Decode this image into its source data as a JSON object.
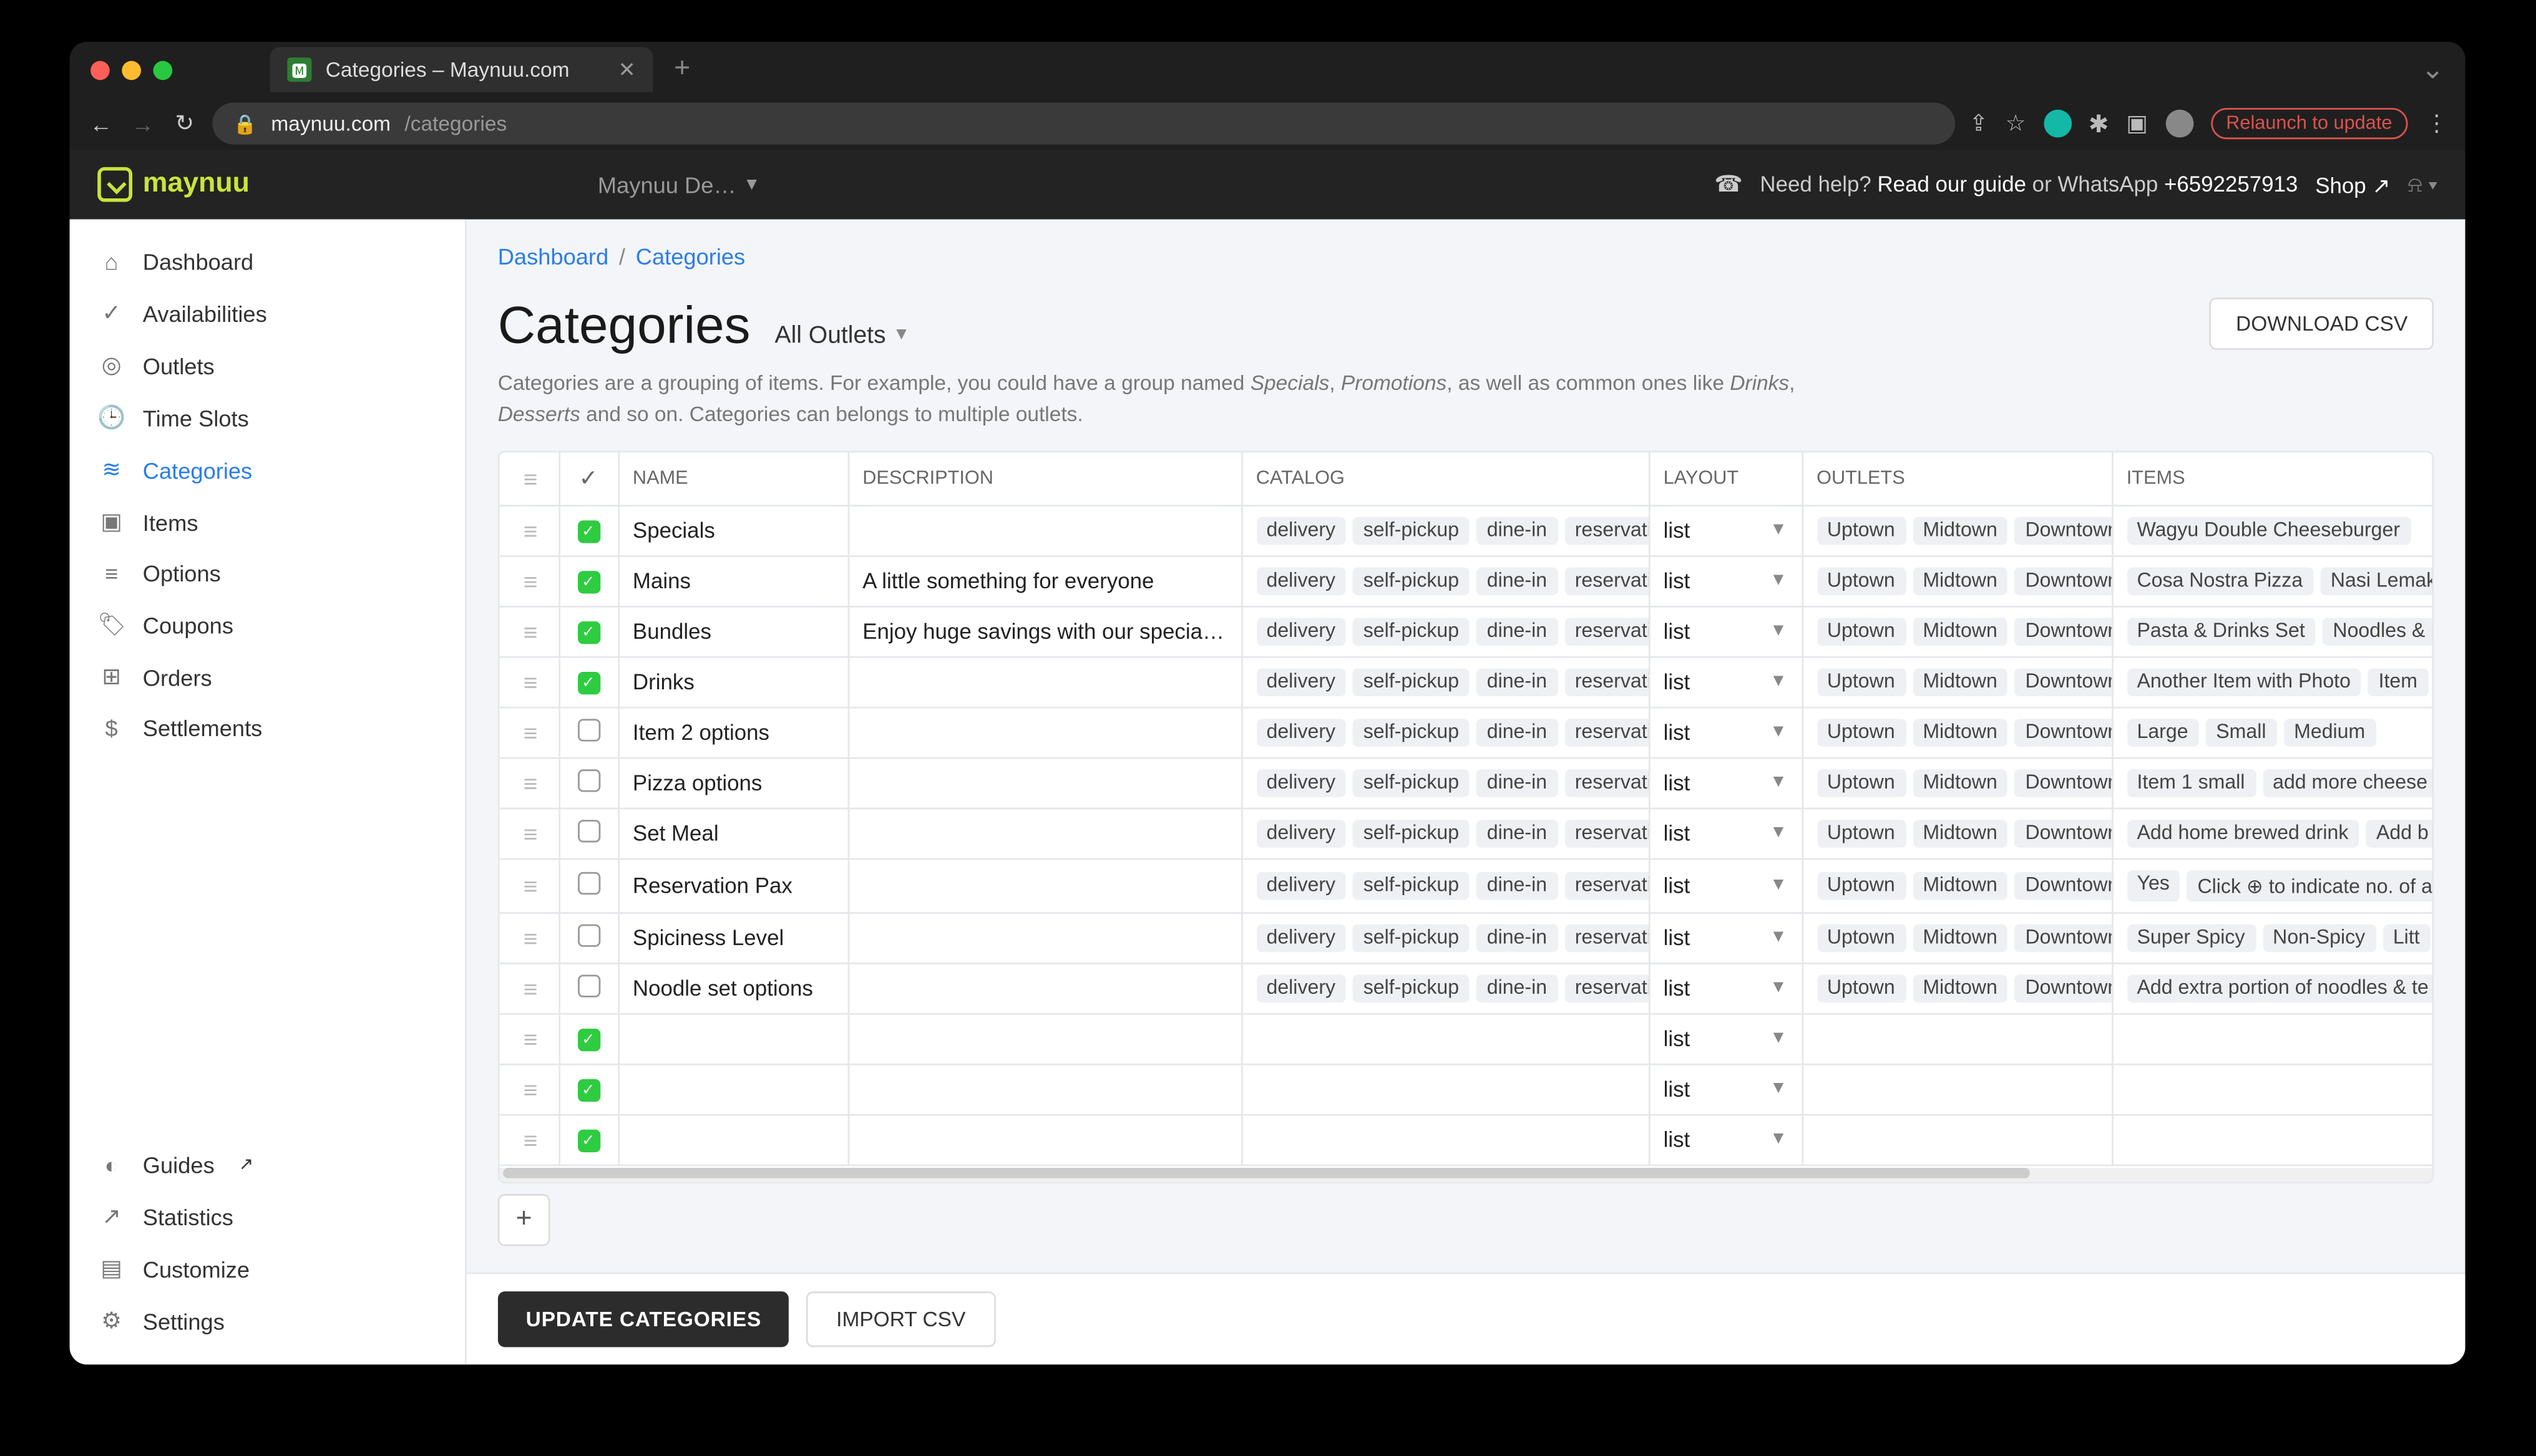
{
  "browser": {
    "tab_title": "Categories – Maynuu.com",
    "url_domain": "maynuu.com",
    "url_path": "/categories",
    "relaunch_label": "Relaunch to update"
  },
  "header": {
    "brand": "maynuu",
    "merchant": "Maynuu De…",
    "help_prefix": "Need help? ",
    "help_guide": "Read our guide",
    "help_or": " or WhatsApp ",
    "help_number": "+6592257913",
    "shop_label": "Shop"
  },
  "sidebar": {
    "top": [
      {
        "icon": "⌂",
        "label": "Dashboard"
      },
      {
        "icon": "✓",
        "label": "Availabilities"
      },
      {
        "icon": "◎",
        "label": "Outlets"
      },
      {
        "icon": "🕒",
        "label": "Time Slots"
      },
      {
        "icon": "≋",
        "label": "Categories",
        "active": true
      },
      {
        "icon": "▣",
        "label": "Items"
      },
      {
        "icon": "≡",
        "label": "Options"
      },
      {
        "icon": "🏷",
        "label": "Coupons"
      },
      {
        "icon": "⊞",
        "label": "Orders"
      },
      {
        "icon": "$",
        "label": "Settlements"
      }
    ],
    "bottom": [
      {
        "icon": "◐",
        "label": "Guides",
        "ext": true
      },
      {
        "icon": "↗",
        "label": "Statistics"
      },
      {
        "icon": "▤",
        "label": "Customize"
      },
      {
        "icon": "⚙",
        "label": "Settings"
      }
    ]
  },
  "breadcrumb": {
    "root": "Dashboard",
    "current": "Categories"
  },
  "page": {
    "title": "Categories",
    "outlet_filter": "All Outlets",
    "desc_1": "Categories are a grouping of items. For example, you could have a group named ",
    "desc_em1": "Specials",
    "desc_sep1": ", ",
    "desc_em2": "Promotions",
    "desc_2": ", as well as common ones like ",
    "desc_em3": "Drinks",
    "desc_sep2": ", ",
    "desc_em4": "Desserts",
    "desc_3": " and so on. Categories can belongs to multiple outlets.",
    "download_csv": "DOWNLOAD CSV"
  },
  "table": {
    "headers": {
      "name": "NAME",
      "description": "DESCRIPTION",
      "catalog": "CATALOG",
      "layout": "LAYOUT",
      "outlets": "OUTLETS",
      "items": "ITEMS"
    },
    "catalog_tags": [
      "delivery",
      "self-pickup",
      "dine-in",
      "reservation"
    ],
    "outlet_tags": [
      "Uptown",
      "Midtown",
      "Downtown"
    ],
    "layout_value": "list",
    "rows": [
      {
        "checked": true,
        "name": "Specials",
        "desc": "",
        "items": [
          "Wagyu Double Cheeseburger"
        ]
      },
      {
        "checked": true,
        "name": "Mains",
        "desc": "A little something for everyone",
        "items": [
          "Cosa Nostra Pizza",
          "Nasi Lemak"
        ]
      },
      {
        "checked": true,
        "name": "Bundles",
        "desc": "Enjoy huge savings with our special bunc",
        "items": [
          "Pasta & Drinks Set",
          "Noodles &"
        ]
      },
      {
        "checked": true,
        "name": "Drinks",
        "desc": "",
        "items": [
          "Another Item with Photo",
          "Item"
        ]
      },
      {
        "checked": false,
        "name": "Item 2 options",
        "desc": "",
        "items": [
          "Large",
          "Small",
          "Medium"
        ]
      },
      {
        "checked": false,
        "name": "Pizza options",
        "desc": "",
        "items": [
          "Item 1 small",
          "add more cheese"
        ]
      },
      {
        "checked": false,
        "name": "Set Meal",
        "desc": "",
        "items": [
          "Add home brewed drink",
          "Add b"
        ]
      },
      {
        "checked": false,
        "name": "Reservation Pax",
        "desc": "",
        "items": [
          "Yes",
          "Click ⊕ to indicate no. of a"
        ]
      },
      {
        "checked": false,
        "name": "Spiciness Level",
        "desc": "",
        "items": [
          "Super Spicy",
          "Non-Spicy",
          "Litt"
        ]
      },
      {
        "checked": false,
        "name": "Noodle set options",
        "desc": "",
        "items": [
          "Add extra portion of noodles & te"
        ]
      },
      {
        "checked": true,
        "name": "",
        "desc": "",
        "empty": true,
        "items": []
      },
      {
        "checked": true,
        "name": "",
        "desc": "",
        "empty": true,
        "items": []
      },
      {
        "checked": true,
        "name": "",
        "desc": "",
        "empty": true,
        "items": []
      }
    ]
  },
  "footer": {
    "update": "UPDATE CATEGORIES",
    "import": "IMPORT CSV"
  }
}
